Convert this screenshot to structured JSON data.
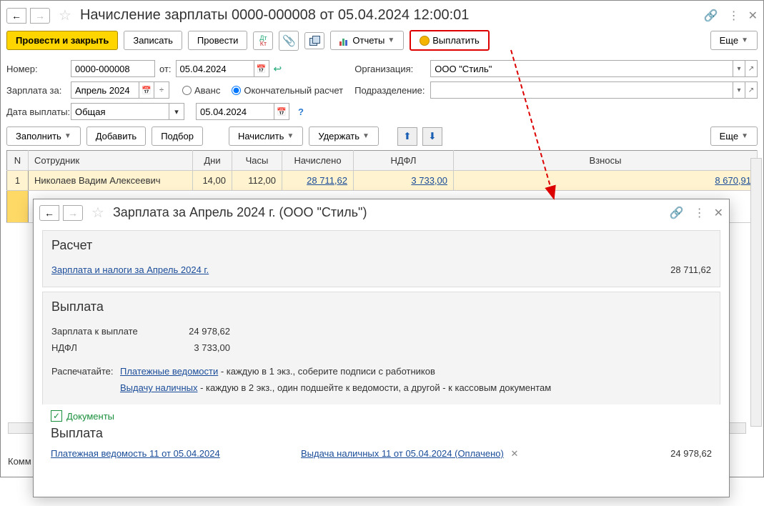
{
  "title": "Начисление зарплаты 0000-000008 от 05.04.2024 12:00:01",
  "toolbar": {
    "post_close": "Провести и закрыть",
    "save": "Записать",
    "post": "Провести",
    "reports": "Отчеты",
    "pay": "Выплатить",
    "more": "Еще"
  },
  "fields": {
    "number_label": "Номер:",
    "number": "0000-000008",
    "date_label": "от:",
    "date": "05.04.2024",
    "org_label": "Организация:",
    "org": "ООО \"Стиль\"",
    "salary_for_label": "Зарплата за:",
    "salary_for": "Апрель 2024",
    "advance": "Аванс",
    "final": "Окончательный расчет",
    "dept_label": "Подразделение:",
    "pay_date_label": "Дата выплаты:",
    "pay_type": "Общая",
    "pay_date": "05.04.2024"
  },
  "toolbar2": {
    "fill": "Заполнить",
    "add": "Добавить",
    "pick": "Подбор",
    "accrue": "Начислить",
    "withhold": "Удержать",
    "more": "Еще"
  },
  "table": {
    "cols": {
      "n": "N",
      "employee": "Сотрудник",
      "days": "Дни",
      "hours": "Часы",
      "accrued": "Начислено",
      "ndfl": "НДФЛ",
      "contrib": "Взносы"
    },
    "rows": [
      {
        "n": "1",
        "employee": "Николаев Вадим Алексеевич",
        "days": "14,00",
        "hours": "112,00",
        "accrued": "28 711,62",
        "ndfl": "3 733,00",
        "contrib": "8 670,91"
      }
    ]
  },
  "comment_label": "Комм",
  "modal": {
    "title": "Зарплата за Апрель 2024 г. (ООО \"Стиль\")",
    "calc": {
      "header": "Расчет",
      "link": "Зарплата и налоги за Апрель 2024 г.",
      "sum": "28 711,62"
    },
    "payout": {
      "header": "Выплата",
      "to_pay_label": "Зарплата к выплате",
      "to_pay": "24 978,62",
      "ndfl_label": "НДФЛ",
      "ndfl": "3 733,00",
      "print_label": "Распечатайте:",
      "link1": "Платежные ведомости",
      "text1": " - каждую в 1 экз., соберите подписи с работников",
      "link2": "Выдачу наличных",
      "text2": " - каждую в 2 экз., один подшейте к ведомости, а другой - к кассовым документам"
    },
    "docs": {
      "header": "Документы",
      "payout_header": "Выплата",
      "doc1": "Платежная ведомость 11 от 05.04.2024",
      "doc2": "Выдача наличных 11 от 05.04.2024 (Оплачено)",
      "sum": "24 978,62"
    }
  }
}
